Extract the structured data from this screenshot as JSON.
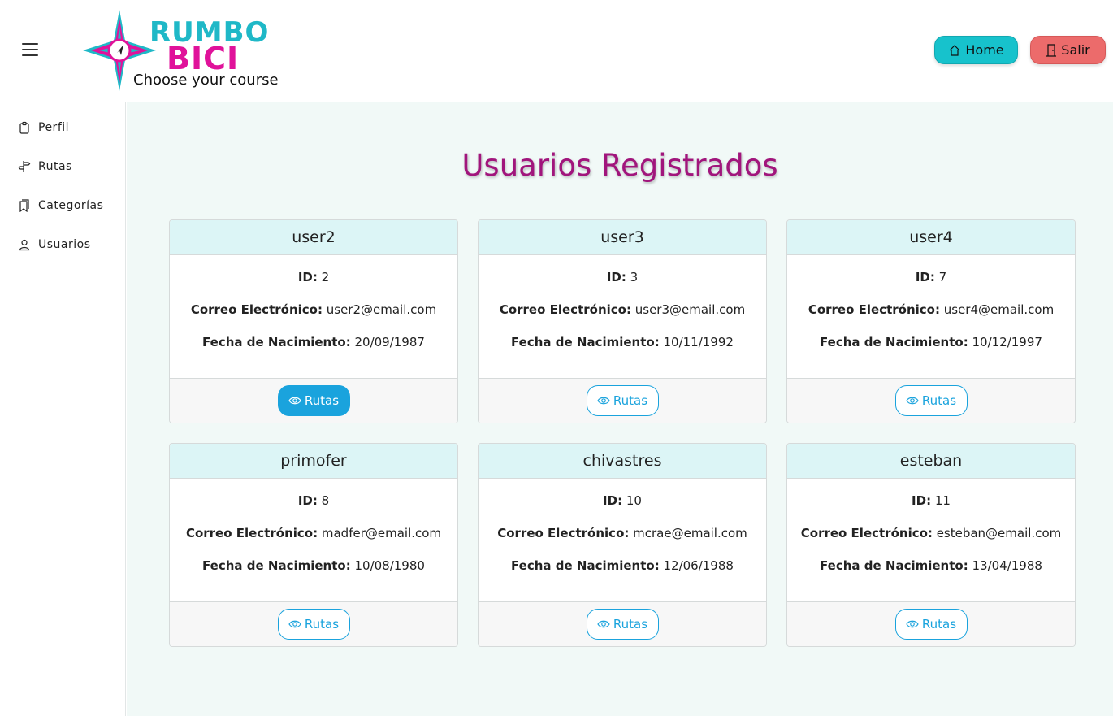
{
  "header": {
    "logo_line1": "RUMBO",
    "logo_line2": "BICI",
    "logo_tagline": "Choose your course",
    "home_label": "Home",
    "salir_label": "Salir"
  },
  "sidebar": {
    "items": [
      {
        "label": "Perfil",
        "icon": "clipboard-icon"
      },
      {
        "label": "Rutas",
        "icon": "signpost-icon"
      },
      {
        "label": "Categorías",
        "icon": "bookmarks-icon"
      },
      {
        "label": "Usuarios",
        "icon": "person-icon"
      }
    ]
  },
  "main": {
    "title": "Usuarios Registrados",
    "labels": {
      "id": "ID",
      "email": "Correo Electrónico",
      "birth": "Fecha de Nacimiento",
      "rutas_button": "Rutas"
    },
    "users": [
      {
        "username": "user2",
        "id": "2",
        "email": "user2@email.com",
        "birth": "20/09/1987"
      },
      {
        "username": "user3",
        "id": "3",
        "email": "user3@email.com",
        "birth": "10/11/1992"
      },
      {
        "username": "user4",
        "id": "7",
        "email": "user4@email.com",
        "birth": "10/12/1997"
      },
      {
        "username": "primofer",
        "id": "8",
        "email": "madfer@email.com",
        "birth": "10/08/1980"
      },
      {
        "username": "chivastres",
        "id": "10",
        "email": "mcrae@email.com",
        "birth": "12/06/1988"
      },
      {
        "username": "esteban",
        "id": "11",
        "email": "esteban@email.com",
        "birth": "13/04/1988"
      }
    ]
  },
  "colors": {
    "accent_teal": "#17c2cc",
    "accent_pink": "#e0129a",
    "title_color": "#a1157c",
    "salir_red": "#ec6b6b",
    "button_blue": "#1aa3dd"
  }
}
